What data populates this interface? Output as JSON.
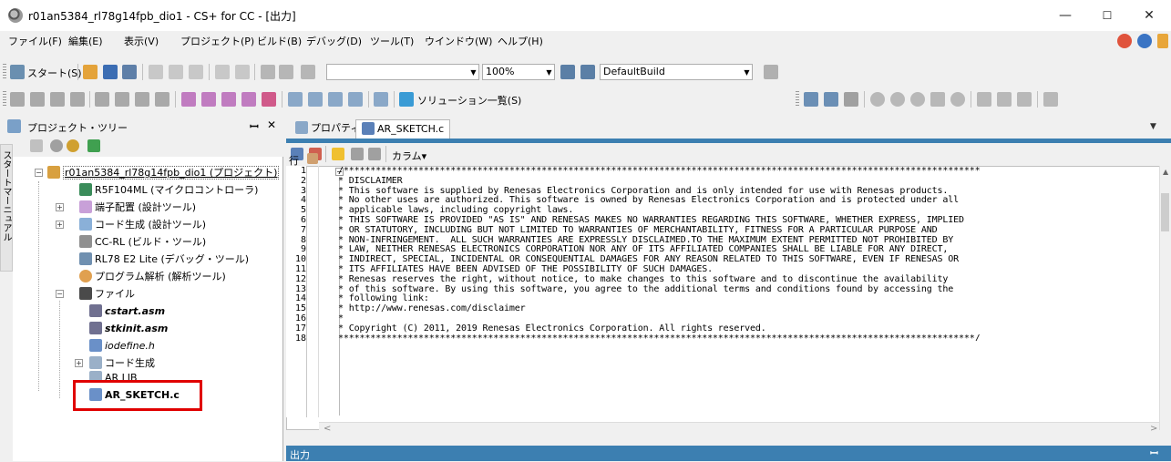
{
  "window": {
    "title": "r01an5384_rl78g14fpb_dio1 - CS+ for CC - [出力]",
    "minimize": "—",
    "maximize": "☐",
    "close": "✕"
  },
  "menu": [
    "ファイル(F)",
    "編集(E)",
    "表示(V)",
    "プロジェクト(P)",
    "ビルド(B)",
    "デバッグ(D)",
    "ツール(T)",
    "ウインドウ(W)",
    "ヘルプ(H)"
  ],
  "toolbar1": {
    "start_label": "スタート(S)",
    "zoom": "100%",
    "build_config": "DefaultBuild"
  },
  "toolbar2": {
    "solution_list": "ソリューション一覧(S)"
  },
  "project_tree": {
    "title": "プロジェクト・ツリー",
    "pin": "ꟷ",
    "close": "✕",
    "left_vtab": "スタートマーニュアル",
    "items": [
      {
        "label": "r01an5384_rl78g14fpb_dio1 (プロジェクト)"
      },
      {
        "label": "R5F104ML (マイクロコントローラ)"
      },
      {
        "label": "端子配置 (設計ツール)"
      },
      {
        "label": "コード生成 (設計ツール)"
      },
      {
        "label": "CC-RL (ビルド・ツール)"
      },
      {
        "label": "RL78 E2 Lite (デバッグ・ツール)"
      },
      {
        "label": "プログラム解析 (解析ツール)"
      },
      {
        "label": "ファイル"
      },
      {
        "label": "cstart.asm"
      },
      {
        "label": "stkinit.asm"
      },
      {
        "label": "iodefine.h"
      },
      {
        "label": "コード生成"
      },
      {
        "label": "AR LIB"
      },
      {
        "label": "AR_SKETCH.c"
      }
    ]
  },
  "editor": {
    "tabs": [
      {
        "label": "プロパティ"
      },
      {
        "label": "AR_SKETCH.c"
      }
    ],
    "column_button": "カラム▾",
    "gutter_label": "行",
    "line_numbers": [
      "1",
      "2",
      "3",
      "4",
      "5",
      "6",
      "7",
      "8",
      "9",
      "10",
      "11",
      "12",
      "13",
      "14",
      "15",
      "16",
      "17",
      "18"
    ],
    "code_lines": [
      "/***********************************************************************************************************************",
      "* DISCLAIMER",
      "* This software is supplied by Renesas Electronics Corporation and is only intended for use with Renesas products.",
      "* No other uses are authorized. This software is owned by Renesas Electronics Corporation and is protected under all",
      "* applicable laws, including copyright laws.",
      "* THIS SOFTWARE IS PROVIDED \"AS IS\" AND RENESAS MAKES NO WARRANTIES REGARDING THIS SOFTWARE, WHETHER EXPRESS, IMPLIED",
      "* OR STATUTORY, INCLUDING BUT NOT LIMITED TO WARRANTIES OF MERCHANTABILITY, FITNESS FOR A PARTICULAR PURPOSE AND",
      "* NON-INFRINGEMENT.  ALL SUCH WARRANTIES ARE EXPRESSLY DISCLAIMED.TO THE MAXIMUM EXTENT PERMITTED NOT PROHIBITED BY",
      "* LAW, NEITHER RENESAS ELECTRONICS CORPORATION NOR ANY OF ITS AFFILIATED COMPANIES SHALL BE LIABLE FOR ANY DIRECT,",
      "* INDIRECT, SPECIAL, INCIDENTAL OR CONSEQUENTIAL DAMAGES FOR ANY REASON RELATED TO THIS SOFTWARE, EVEN IF RENESAS OR",
      "* ITS AFFILIATES HAVE BEEN ADVISED OF THE POSSIBILITY OF SUCH DAMAGES.",
      "* Renesas reserves the right, without notice, to make changes to this software and to discontinue the availability",
      "* of this software. By using this software, you agree to the additional terms and conditions found by accessing the",
      "* following link:",
      "* http://www.renesas.com/disclaimer",
      "*",
      "* Copyright (C) 2011, 2019 Renesas Electronics Corporation. All rights reserved.",
      "***********************************************************************************************************************/"
    ]
  },
  "output_panel": {
    "label": "出力",
    "pin": "ꟷ"
  }
}
